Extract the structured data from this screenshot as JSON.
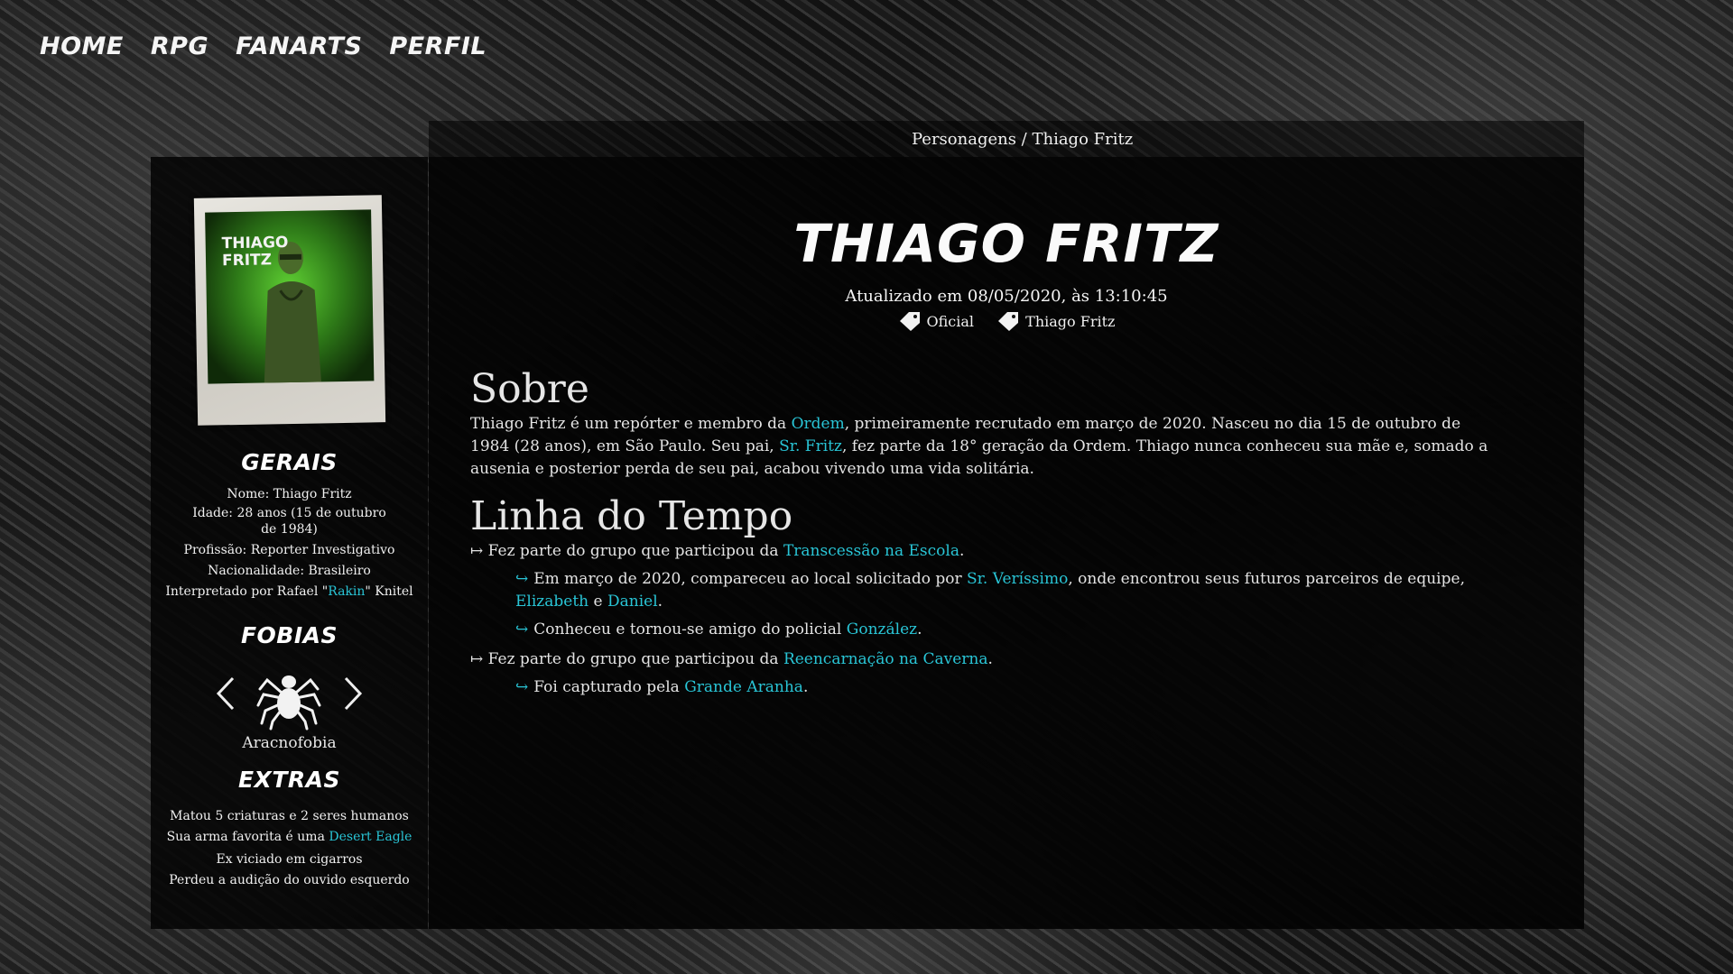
{
  "nav": [
    "HOME",
    "RPG",
    "FANARTS",
    "PERFIL"
  ],
  "breadcrumb": "Personagens / Thiago Fritz",
  "sidebar": {
    "photo_label": "THIAGO\nFRITZ",
    "gerais_title": "GERAIS",
    "nome": "Nome: Thiago Fritz",
    "idade": "Idade: 28 anos (15 de outubro de 1984)",
    "profissao": "Profissão: Reporter Investigativo",
    "nacionalidade": "Nacionalidade: Brasileiro",
    "interpretado_prefix": "Interpretado por Rafael \"",
    "interpretado_link": "Rakin",
    "interpretado_suffix": "\" Knitel",
    "fobias_title": "FOBIAS",
    "fobia_icon": "spider-icon",
    "fobia_label": "Aracnofobia",
    "extras_title": "EXTRAS",
    "extra1": "Matou 5 criaturas e 2 seres humanos",
    "extra2_prefix": "Sua arma favorita é uma ",
    "extra2_link": "Desert Eagle",
    "extra3": "Ex viciado em cigarros",
    "extra4": "Perdeu a audição do ouvido esquerdo"
  },
  "main": {
    "title": "THIAGO FRITZ",
    "updated": "Atualizado em 08/05/2020, às 13:10:45",
    "tags": [
      "Oficial",
      "Thiago Fritz"
    ],
    "sobre_title": "Sobre",
    "sobre_p": {
      "t1": "Thiago Fritz é um repórter e membro da ",
      "l1": "Ordem",
      "t2": ", primeiramente recrutado em março de 2020. Nasceu no dia 15 de outubro de 1984 (28 anos), em São Paulo. Seu pai, ",
      "l2": "Sr. Fritz",
      "t3": ", fez parte da 18° geração da Ordem. Thiago nunca conheceu sua mãe e, somado a ausenia e posterior perda de seu pai, acabou vivendo uma vida solitária."
    },
    "linha_title": "Linha do Tempo",
    "timeline": {
      "e1": {
        "t1": "↦ Fez parte do grupo que participou da ",
        "l1": "Transcessão na Escola",
        "t2": "."
      },
      "e1a": {
        "t1": "Em março de 2020, compareceu ao local solicitado por ",
        "l1": "Sr. Veríssimo",
        "t2": ", onde encontrou seus futuros parceiros de equipe, ",
        "l2": "Elizabeth",
        "t3": " e ",
        "l3": "Daniel",
        "t4": "."
      },
      "e1b": {
        "t1": "Conheceu e tornou-se amigo do policial ",
        "l1": "González",
        "t2": "."
      },
      "e2": {
        "t1": "↦ Fez parte do grupo que participou da ",
        "l1": "Reencarnação na Caverna",
        "t2": "."
      },
      "e2a": {
        "t1": "Foi capturado pela ",
        "l1": "Grande Aranha",
        "t2": "."
      }
    }
  },
  "colors": {
    "link": "#29c5d6",
    "accent_green": "#5fd033"
  }
}
